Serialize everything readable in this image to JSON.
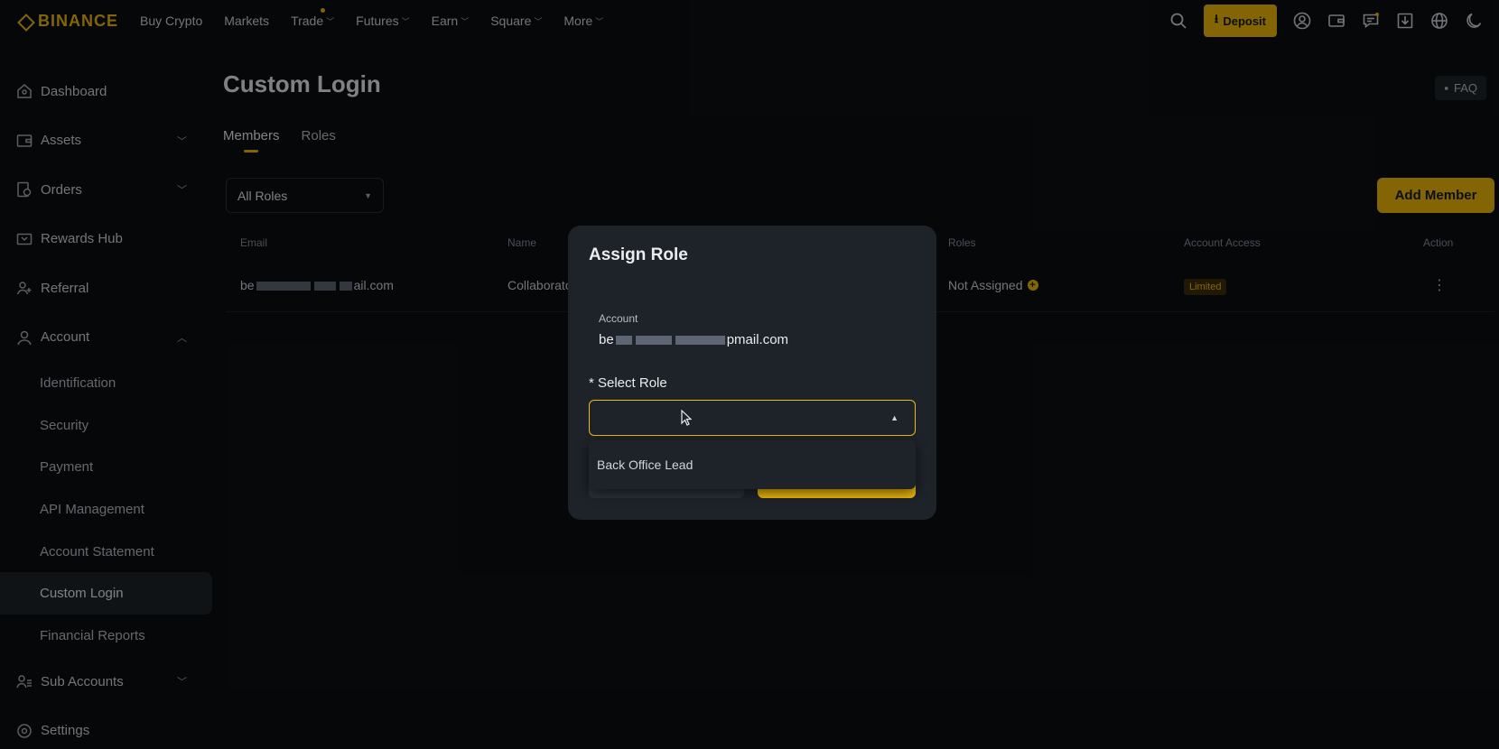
{
  "topnav": {
    "logo": "BINANCE",
    "items": [
      {
        "label": "Buy Crypto",
        "has_chevron": false
      },
      {
        "label": "Markets",
        "has_chevron": false
      },
      {
        "label": "Trade",
        "has_chevron": true,
        "has_dot": true
      },
      {
        "label": "Futures",
        "has_chevron": true
      },
      {
        "label": "Earn",
        "has_chevron": true
      },
      {
        "label": "Square",
        "has_chevron": true
      },
      {
        "label": "More",
        "has_chevron": true
      }
    ],
    "deposit_label": "Deposit",
    "icons": [
      "search-icon",
      "user-icon",
      "wallet-icon",
      "message-icon",
      "download-icon",
      "globe-icon",
      "moon-icon"
    ]
  },
  "sidebar": {
    "items": [
      {
        "label": "Dashboard",
        "icon": "home-icon"
      },
      {
        "label": "Assets",
        "icon": "wallet-icon",
        "chevron": "down"
      },
      {
        "label": "Orders",
        "icon": "orders-icon",
        "chevron": "down"
      },
      {
        "label": "Rewards Hub",
        "icon": "ticket-icon"
      },
      {
        "label": "Referral",
        "icon": "user-plus-icon"
      },
      {
        "label": "Account",
        "icon": "user-icon",
        "chevron": "up"
      }
    ],
    "sub_items": [
      "Identification",
      "Security",
      "Payment",
      "API Management",
      "Account Statement",
      "Custom Login",
      "Financial Reports"
    ],
    "active_sub": "Custom Login",
    "bottom_items": [
      {
        "label": "Sub Accounts",
        "icon": "sub-accounts-icon",
        "chevron": "down"
      },
      {
        "label": "Settings",
        "icon": "settings-icon"
      }
    ]
  },
  "main": {
    "title": "Custom Login",
    "faq_label": "FAQ",
    "tabs": [
      "Members",
      "Roles"
    ],
    "active_tab": "Members",
    "roles_filter": "All Roles",
    "add_member_label": "Add Member",
    "table": {
      "headers": {
        "email": "Email",
        "name": "Name",
        "roles": "Roles",
        "access": "Account Access",
        "action": "Action"
      },
      "rows": [
        {
          "email_prefix": "be",
          "email_suffix": "ail.com",
          "name": "Collaborato",
          "roles": "Not Assigned",
          "access": "Limited"
        }
      ]
    }
  },
  "modal": {
    "title": "Assign Role",
    "account_label": "Account",
    "account_prefix": "be",
    "account_suffix": "pmail.com",
    "select_label": "* Select Role",
    "select_value": "",
    "dropdown_options": [
      "Back Office Lead"
    ]
  },
  "colors": {
    "accent": "#f0b90b",
    "background": "#0b0e11",
    "modal": "#1e2329"
  }
}
